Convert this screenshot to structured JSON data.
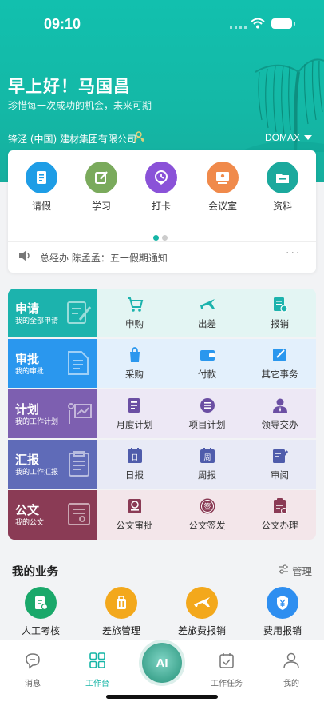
{
  "status": {
    "time": "09:10"
  },
  "header": {
    "greeting": "早上好！马国昌",
    "motto": "珍惜每一次成功的机会，未来可期",
    "company": "锋泾 (中国) 建材集团有限公司",
    "domain": "DOMAX"
  },
  "quick": [
    {
      "label": "请假",
      "icon": "leave-doc-icon",
      "color": "#1e9de6"
    },
    {
      "label": "学习",
      "icon": "study-edit-icon",
      "color": "#7aaa5c"
    },
    {
      "label": "打卡",
      "icon": "clock-pin-icon",
      "color": "#8a52d8"
    },
    {
      "label": "会议室",
      "icon": "meeting-room-icon",
      "color": "#f08a4b"
    },
    {
      "label": "资料",
      "icon": "folder-icon",
      "color": "#1ba99d"
    }
  ],
  "notice": {
    "text": "总经办 陈孟孟：五一假期通知",
    "more": "···"
  },
  "grid": [
    {
      "title": "申请",
      "subtitle": "我的全部申请",
      "color": "#1cb3ad",
      "bg": "#e3f5f3",
      "items": [
        {
          "label": "申购",
          "icon": "cart-icon"
        },
        {
          "label": "出差",
          "icon": "plane-icon"
        },
        {
          "label": "报销",
          "icon": "reimburse-icon"
        }
      ]
    },
    {
      "title": "审批",
      "subtitle": "我的审批",
      "color": "#2a97ee",
      "bg": "#e3f0fc",
      "items": [
        {
          "label": "采购",
          "icon": "purchase-icon"
        },
        {
          "label": "付款",
          "icon": "wallet-icon"
        },
        {
          "label": "其它事务",
          "icon": "other-edit-icon"
        }
      ]
    },
    {
      "title": "计划",
      "subtitle": "我的工作计划",
      "color": "#7d5fb0",
      "bg": "#ede8f5",
      "items": [
        {
          "label": "月度计划",
          "icon": "monthly-plan-icon"
        },
        {
          "label": "项目计划",
          "icon": "project-list-icon"
        },
        {
          "label": "领导交办",
          "icon": "leader-icon"
        }
      ]
    },
    {
      "title": "汇报",
      "subtitle": "我的工作汇报",
      "color": "#5f6bb8",
      "bg": "#e8eaf6",
      "items": [
        {
          "label": "日报",
          "icon": "daily-calendar-icon",
          "glyph": "日"
        },
        {
          "label": "周报",
          "icon": "weekly-calendar-icon",
          "glyph": "周"
        },
        {
          "label": "审阅",
          "icon": "review-icon"
        }
      ]
    },
    {
      "title": "公文",
      "subtitle": "我的公文",
      "color": "#8a3b55",
      "bg": "#f3e6ea",
      "items": [
        {
          "label": "公文审批",
          "icon": "doc-approve-icon"
        },
        {
          "label": "公文签发",
          "icon": "doc-sign-icon",
          "glyph": "签"
        },
        {
          "label": "公文办理",
          "icon": "doc-handle-icon"
        }
      ]
    }
  ],
  "business": {
    "title": "我的业务",
    "manage": "管理",
    "items": [
      {
        "label": "人工考核",
        "icon": "assessment-icon",
        "color": "#1aa86a"
      },
      {
        "label": "差旅管理",
        "icon": "luggage-icon",
        "color": "#f3a81c"
      },
      {
        "label": "差旅费报销",
        "icon": "plane-expense-icon",
        "color": "#f3a81c"
      },
      {
        "label": "费用报销",
        "icon": "yen-shield-icon",
        "color": "#2e8ef0"
      }
    ]
  },
  "tabs": [
    {
      "label": "消息",
      "icon": "message-icon"
    },
    {
      "label": "工作台",
      "icon": "workbench-icon",
      "active": true
    },
    {
      "label": "AI",
      "icon": "ai-icon"
    },
    {
      "label": "工作任务",
      "icon": "task-calendar-icon"
    },
    {
      "label": "我的",
      "icon": "profile-icon"
    }
  ],
  "accent": "#15b5a6"
}
